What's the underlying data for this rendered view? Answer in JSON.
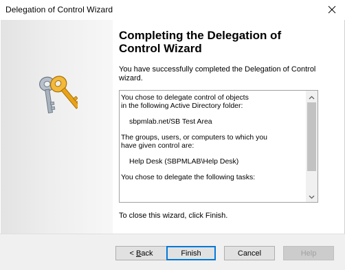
{
  "window": {
    "title": "Delegation of Control Wizard"
  },
  "icons": {
    "close": "close-icon",
    "keys": "keys-icon",
    "scroll_up": "chevron-up-icon",
    "scroll_down": "chevron-down-icon"
  },
  "colors": {
    "key_gold": "#e8a317",
    "key_silver": "#9aa5b1",
    "primary_button_border": "#0078d7",
    "left_panel": "#e8e8e8"
  },
  "main": {
    "heading": "Completing the Delegation of Control Wizard",
    "success_text": "You have successfully completed the Delegation of Control wizard.",
    "close_hint": "To close this wizard, click Finish."
  },
  "summary": {
    "line1": "You chose to delegate control of objects",
    "line2": "in the following Active Directory folder:",
    "folder": "sbpmlab.net/SB Test Area",
    "line3": "The groups, users, or computers to which you",
    "line4": "have given control are:",
    "group": "Help Desk (SBPMLAB\\Help Desk)",
    "line5": "You chose to delegate the following tasks:"
  },
  "buttons": {
    "back_prefix": "< ",
    "back_mnemonic": "B",
    "back_rest": "ack",
    "finish": "Finish",
    "cancel": "Cancel",
    "help": "Help"
  }
}
